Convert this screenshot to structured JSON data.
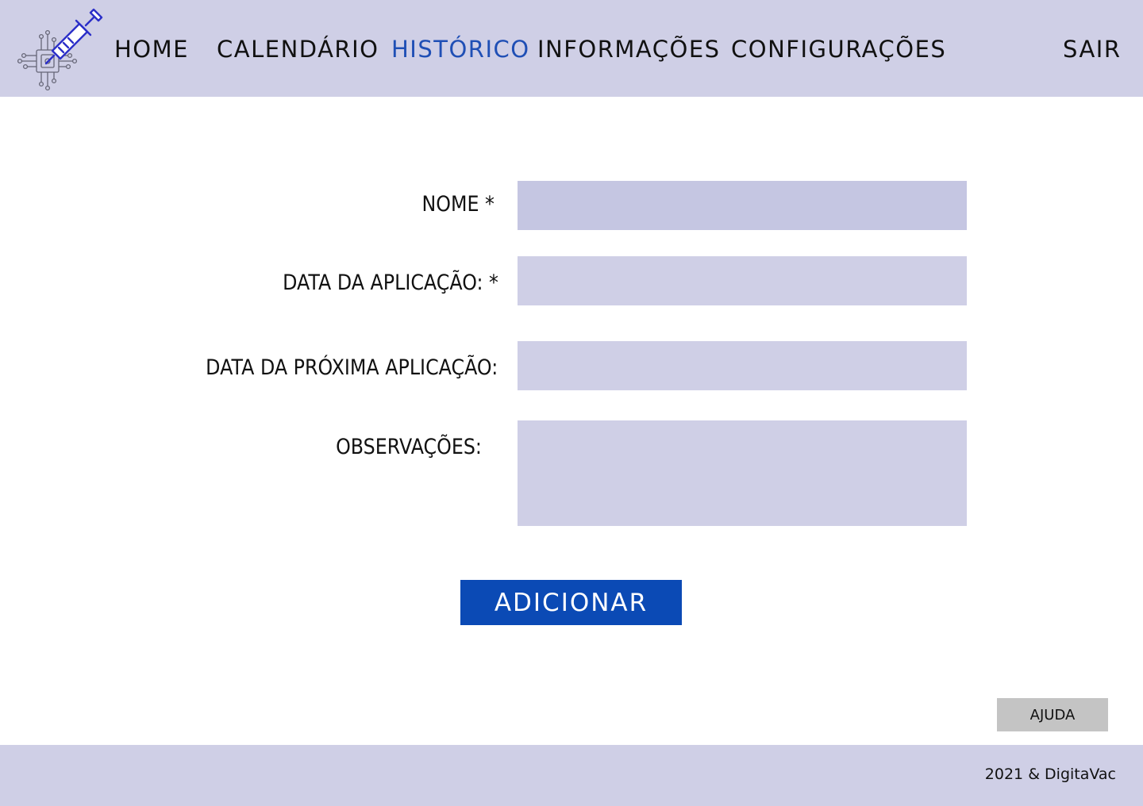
{
  "nav": {
    "items": [
      {
        "label": "HOME"
      },
      {
        "label": "CALENDÁRIO"
      },
      {
        "label": "HISTÓRICO",
        "active": true
      },
      {
        "label": "INFORMAÇÕES"
      },
      {
        "label": "CONFIGURAÇÕES"
      }
    ],
    "logout": "SAIR",
    "logo_icon": "syringe-circuit-icon"
  },
  "form": {
    "fields": [
      {
        "label": "NOME *",
        "value": ""
      },
      {
        "label": "DATA DA APLICAÇÃO: *",
        "value": ""
      },
      {
        "label": "DATA DA PRÓXIMA APLICAÇÃO:",
        "value": ""
      },
      {
        "label": "OBSERVAÇÕES:",
        "value": ""
      }
    ],
    "submit_label": "ADICIONAR"
  },
  "help_label": "AJUDA",
  "footer": {
    "text": "2021 & DigitaVac"
  },
  "colors": {
    "nav_background": "#cfcfe6",
    "active_nav": "#1f4fb5",
    "name_field": "#c5c6e2",
    "field_background": "#cfcfe6",
    "primary_button": "#0b4ab5",
    "help_button": "#c4c4c4",
    "logo_stroke": "#2b2fc8"
  }
}
